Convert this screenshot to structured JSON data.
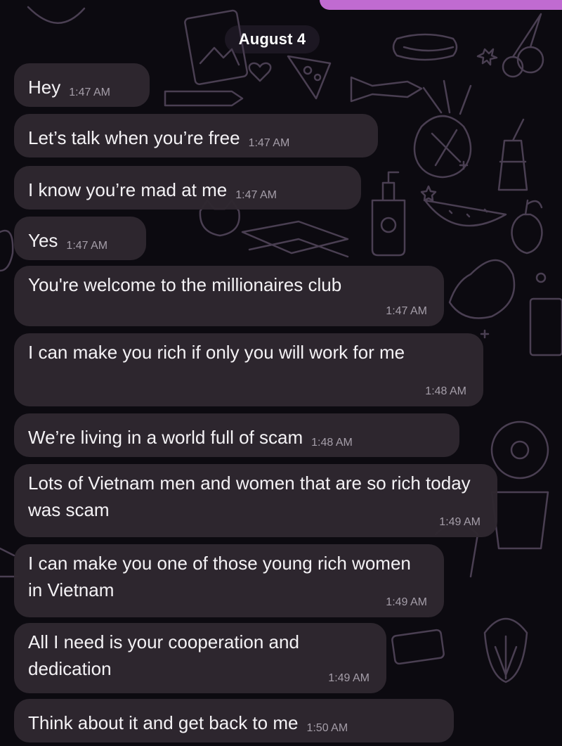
{
  "date_header": "August 4",
  "messages": [
    {
      "text": "Hey",
      "time": "1:47 AM"
    },
    {
      "text": "Let’s talk when you’re free",
      "time": "1:47 AM"
    },
    {
      "text": "I know you’re mad at me",
      "time": "1:47 AM"
    },
    {
      "text": "Yes",
      "time": "1:47 AM"
    },
    {
      "text": "You're welcome to the millionaires club",
      "time": "1:47 AM"
    },
    {
      "text": "I can make you rich  if only you will work for me",
      "time": "1:48 AM"
    },
    {
      "text": "We’re living in a world full of scam",
      "time": "1:48 AM"
    },
    {
      "text": "Lots of Vietnam men and women that are so rich today was scam",
      "time": "1:49 AM"
    },
    {
      "text": "I can make you one of those young rich women in Vietnam",
      "time": "1:49 AM"
    },
    {
      "text": "All I need is your cooperation and dedication",
      "time": "1:49 AM"
    },
    {
      "text": "Think about it and get back to me",
      "time": "1:50 AM"
    }
  ],
  "colors": {
    "background": "#0c0a10",
    "bubble": "#2e2730",
    "text": "#f4f2f5",
    "timestamp": "#a59ea9",
    "accent": "#c06bd1",
    "doodle": "#4a3f52"
  },
  "background_pattern": "food-doodle-wallpaper"
}
